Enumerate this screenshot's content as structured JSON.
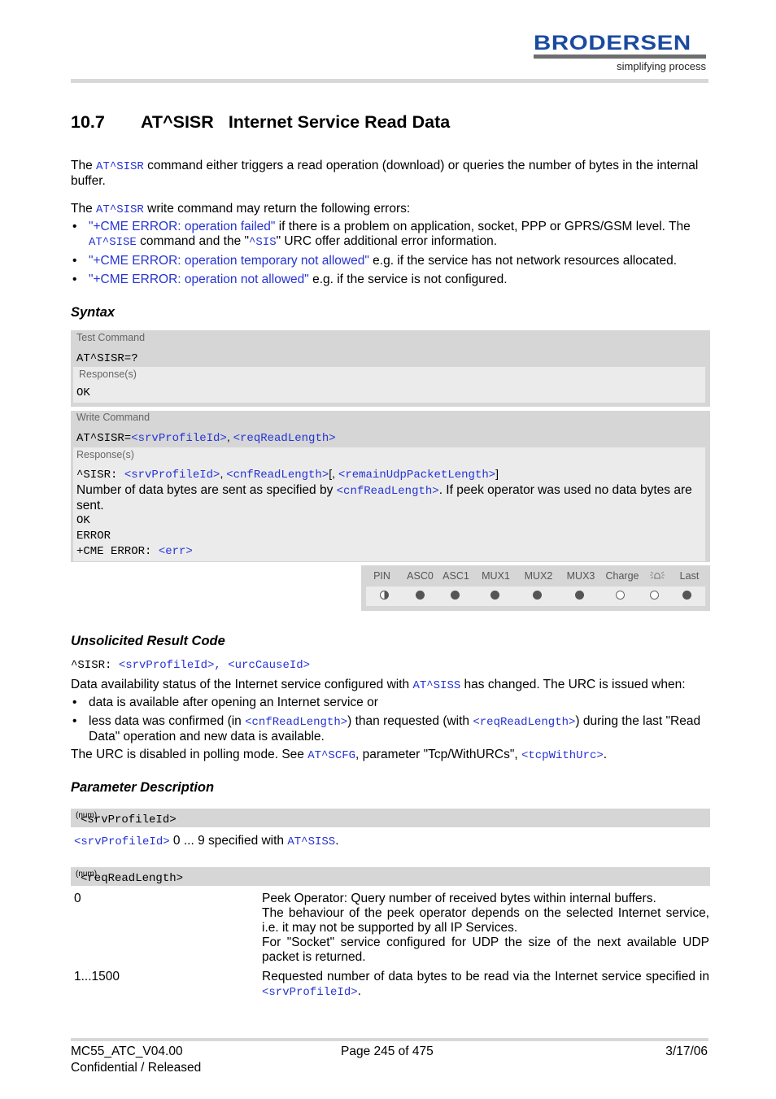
{
  "header": {
    "brand": "BRODERSEN",
    "tagline": "simplifying process"
  },
  "title": {
    "number": "10.7",
    "command": "AT^SISR",
    "text": "Internet Service Read Data"
  },
  "intro": {
    "p1_pre": "The ",
    "p1_cmd": "AT^SISR",
    "p1_post": " command either triggers a read operation (download) or queries the number of bytes in the internal buffer.",
    "p2_pre": "The ",
    "p2_cmd": "AT^SISR",
    "p2_post": " write command may return the following errors:",
    "errors": [
      {
        "link": "\"+CME ERROR: operation failed\"",
        "text": " if there is a problem on application, socket, PPP or GPRS/GSM level. The ",
        "cmd1": "AT^SISE",
        "mid": " command and the \"",
        "cmd2": "^SIS",
        "end": "\" URC offer additional error information."
      },
      {
        "link": "\"+CME ERROR: operation temporary not allowed\"",
        "text": " e.g. if the service has not network resources allocated."
      },
      {
        "link": "\"+CME ERROR: operation not allowed\"",
        "text": " e.g. if the service is not configured."
      }
    ]
  },
  "syntax": {
    "heading": "Syntax",
    "test": {
      "label": "Test Command",
      "command": "AT^SISR=?",
      "response_label": "Response(s)",
      "response": "OK"
    },
    "write": {
      "label": "Write Command",
      "cmd_prefix": "AT^SISR=",
      "param1": "<srvProfileId>",
      "sep": ", ",
      "param2": "<reqReadLength>",
      "response_label": "Response(s)",
      "resp_prefix": "^SISR: ",
      "resp_p1": "<srvProfileId>",
      "resp_sep": ", ",
      "resp_p2": "<cnfReadLength>",
      "resp_br": "[, ",
      "resp_p3": "<remainUdpPacketLength>",
      "resp_end": "]",
      "desc_pre": "Number of data bytes are sent as specified by ",
      "desc_link": "<cnfReadLength>",
      "desc_post": ". If peek operator was used no data bytes are sent.",
      "ok": "OK",
      "error": "ERROR",
      "cme_prefix": "+CME ERROR: ",
      "cme_param": "<err>"
    },
    "pin_table": {
      "headers": [
        "PIN",
        "ASC0",
        "ASC1",
        "MUX1",
        "MUX2",
        "MUX3",
        "Charge",
        "alarm-icon",
        "Last"
      ],
      "values": [
        "half",
        "full",
        "full",
        "full",
        "full",
        "full",
        "empty",
        "empty",
        "full"
      ]
    }
  },
  "urc": {
    "heading": "Unsolicited Result Code",
    "code_prefix": "^SISR: ",
    "code_params": "<srvProfileId>, <urcCauseId>",
    "desc_pre": "Data availability status of the Internet service configured with ",
    "desc_cmd": "AT^SISS",
    "desc_post": " has changed. The URC is issued when:",
    "bullets": [
      {
        "text": "data is available after opening an Internet service or"
      },
      {
        "pre": "less data was confirmed (in ",
        "p1": "<cnfReadLength>",
        "mid": ") than requested (with ",
        "p2": "<reqReadLength>",
        "post": ") during the last \"Read Data\" operation and new data is available."
      }
    ],
    "note_pre": "The URC is disabled in polling mode. See ",
    "note_cmd": "AT^SCFG",
    "note_mid": ", parameter \"Tcp/WithURCs\", ",
    "note_param": "<tcpWithUrc>",
    "note_end": "."
  },
  "params": {
    "heading": "Parameter Description",
    "srvProfileId": {
      "name": "<srvProfileId>",
      "type": "(num)",
      "desc_link": "<srvProfileId>",
      "desc_mid": " 0 ... 9 specified with ",
      "desc_cmd": "AT^SISS",
      "desc_end": "."
    },
    "reqReadLength": {
      "name": "<reqReadLength>",
      "type": "(num)",
      "values": [
        {
          "value": "0",
          "lines": [
            "Peek Operator: Query number of received bytes within internal buffers.",
            "The behaviour of the peek operator depends on the selected Internet service, i.e. it may not be supported by all IP Services.",
            "For \"Socket\" service configured for UDP the size of the next available UDP packet is returned."
          ]
        },
        {
          "value": "1...1500",
          "pre": "Requested number of data bytes to be read via the Internet service specified in ",
          "link": "<srvProfileId>",
          "end": "."
        }
      ]
    }
  },
  "footer": {
    "doc_id": "MC55_ATC_V04.00",
    "page": "Page 245 of 475",
    "date": "3/17/06",
    "status": "Confidential / Released"
  }
}
